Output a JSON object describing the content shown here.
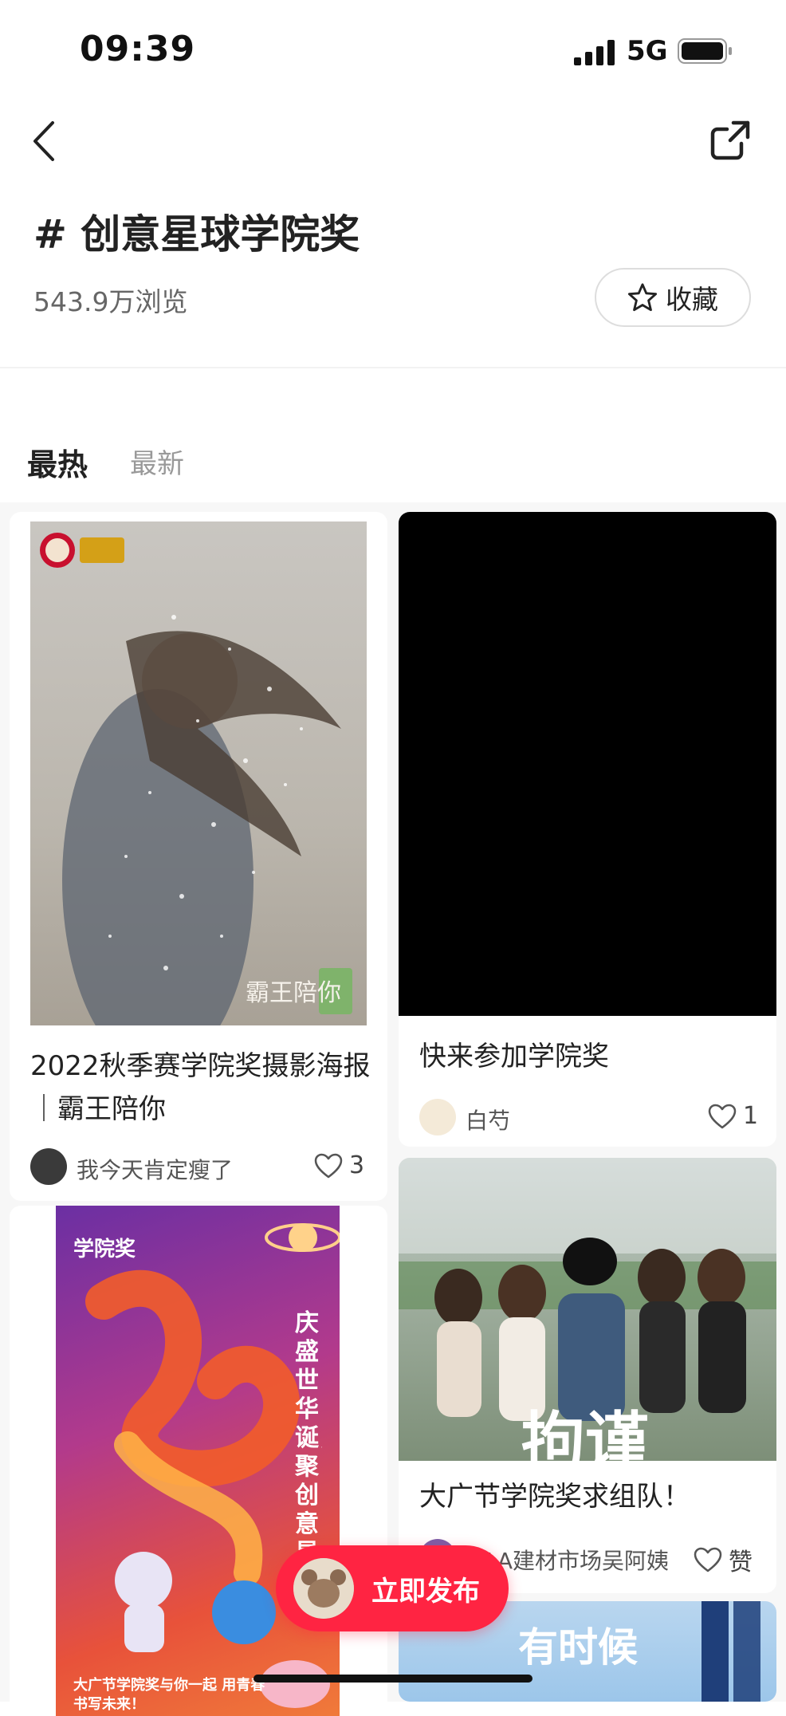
{
  "status_bar": {
    "time": "09:39",
    "network": "5G"
  },
  "header": {
    "title": "# 创意星球学院奖",
    "views": "543.9万浏览",
    "favorite_label": "收藏"
  },
  "tabs": [
    {
      "label": "最热"
    },
    {
      "label": "最新"
    }
  ],
  "posts": [
    {
      "title": "2022秋季赛学院奖摄影海报｜霸王陪你",
      "author": "我今天肯定瘦了",
      "likes": "3",
      "image_text": "霸王陪你"
    },
    {
      "title": "快来参加学院奖",
      "author": "白芍",
      "likes": "1"
    },
    {
      "title": "",
      "author": "",
      "likes": "",
      "image_text": "学院奖",
      "image_caption": "庆盛世华诞，聚创意星火",
      "image_footer": "大广节学院奖与你一起 用青春书写未来！"
    },
    {
      "title": "大广节学院奖求组队！",
      "author": "AAA建材市场吴阿姨",
      "likes": "赞",
      "image_text": "拘谨"
    },
    {
      "title": "",
      "author": "",
      "likes": "",
      "image_text": "有时候"
    }
  ],
  "publish_button": {
    "label": "立即发布"
  },
  "colors": {
    "accent": "#ff2442",
    "background": "#ffffff",
    "feed_background": "#f7f7f7"
  }
}
